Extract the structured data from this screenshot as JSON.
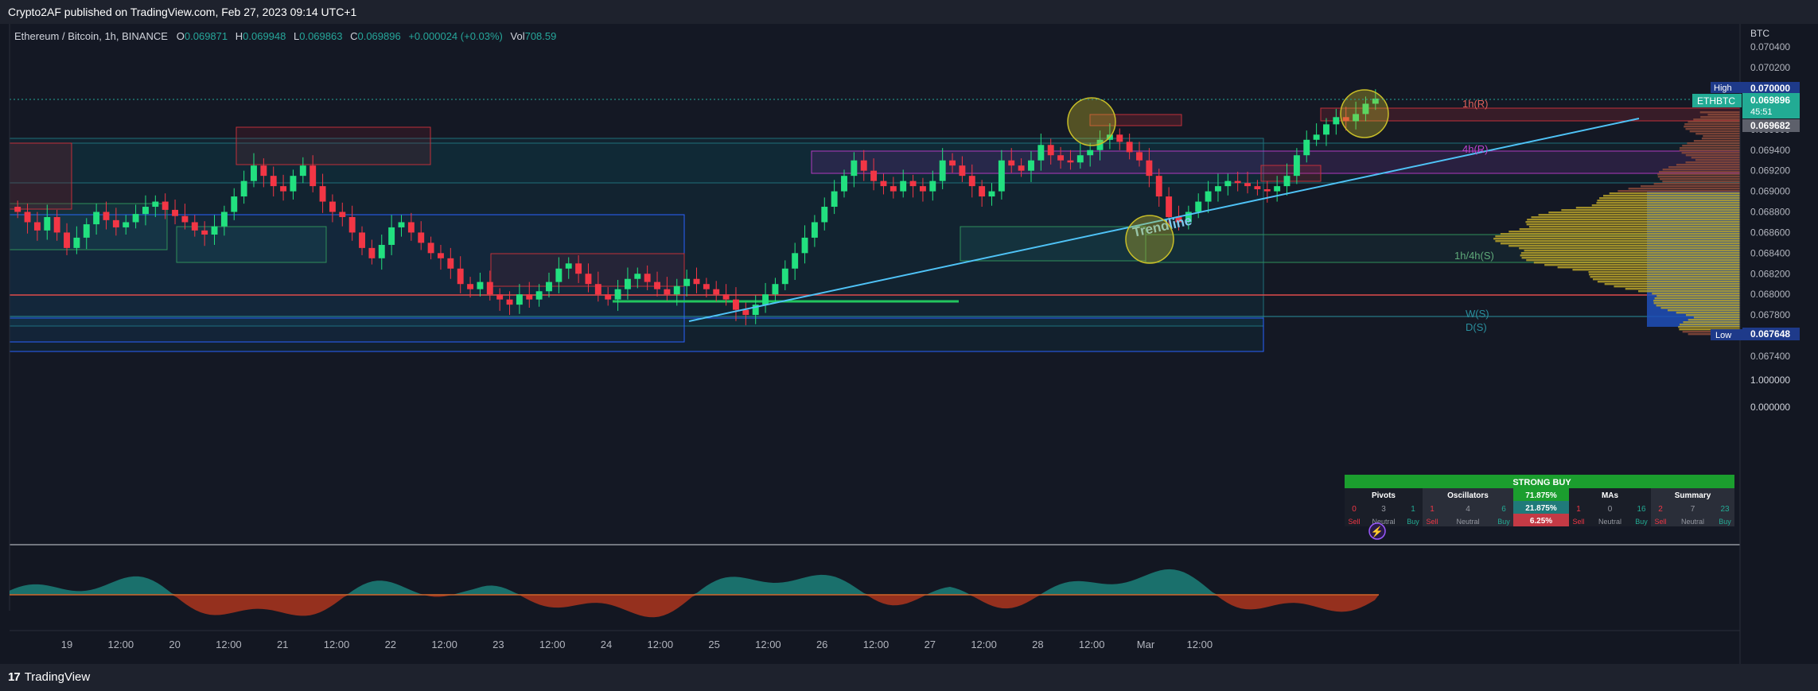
{
  "header": {
    "published": "Crypto2AF published on TradingView.com, Feb 27, 2023 09:14 UTC+1"
  },
  "footer": {
    "brand": "TradingView",
    "logo_mark": "17"
  },
  "legend": {
    "symbol": "Ethereum / Bitcoin, 1h, BINANCE",
    "o_label": "O",
    "o": "0.069871",
    "h_label": "H",
    "h": "0.069948",
    "l_label": "L",
    "l": "0.069863",
    "c_label": "C",
    "c": "0.069896",
    "change": "+0.000024 (+0.03%)",
    "vol_label": "Vol",
    "vol": "708.59"
  },
  "price_scale": {
    "currency": "BTC",
    "ticks": [
      "0.070400",
      "0.070200",
      "0.070000",
      "0.069800",
      "0.069600",
      "0.069400",
      "0.069200",
      "0.069000",
      "0.068800",
      "0.068600",
      "0.068400",
      "0.068200",
      "0.068000",
      "0.067800",
      "0.067600",
      "0.067400"
    ],
    "high_label": "High",
    "high_value": "0.070000",
    "symbol_tag": "ETHBTC",
    "last_price": "0.069896",
    "countdown": "45:51",
    "level_value": "0.069682",
    "low_label": "Low",
    "low_value": "0.067648"
  },
  "osc_scale": {
    "ticks": [
      "1.000000",
      "0.000000"
    ]
  },
  "time_axis": [
    "19",
    "12:00",
    "20",
    "12:00",
    "21",
    "12:00",
    "22",
    "12:00",
    "23",
    "12:00",
    "24",
    "12:00",
    "25",
    "12:00",
    "26",
    "12:00",
    "27",
    "12:00",
    "28",
    "12:00",
    "Mar",
    "12:00"
  ],
  "annotations": {
    "r1h": "1h(R)",
    "r4h": "4h(R)",
    "s1h4h": "1h/4h(S)",
    "sw": "W(S)",
    "sd": "D(S)",
    "trendline": "Trendline"
  },
  "ta_panel": {
    "summary_text": "STRONG BUY",
    "columns": [
      {
        "title": "Pivots",
        "sell": "0",
        "neutral": "3",
        "buy": "1"
      },
      {
        "title": "Oscillators",
        "sell": "1",
        "neutral": "4",
        "buy": "6"
      },
      {
        "title": "MAs",
        "sell": "1",
        "neutral": "0",
        "buy": "16"
      },
      {
        "title": "Summary",
        "sell": "2",
        "neutral": "7",
        "buy": "23"
      }
    ],
    "pct_buy": "71.875%",
    "pct_neutral": "21.875%",
    "pct_sell": "6.25%",
    "sell_label": "Sell",
    "neutral_label": "Neutral",
    "buy_label": "Buy"
  },
  "colors": {
    "up": "#26a69a",
    "up_bright": "#22e07f",
    "down": "#f23645",
    "trendline": "#4fc3f7",
    "bg": "#131722",
    "panel": "#1e222d",
    "buy": "#22ab94",
    "sell": "#f23645"
  },
  "chart_data": {
    "type": "candlestick",
    "symbol": "ETHBTC",
    "timeframe": "1h",
    "x_range": [
      "Feb 19",
      "Mar 1 12:00"
    ],
    "ylim": [
      0.0673,
      0.0705
    ],
    "close_series": [
      0.0688,
      0.0687,
      0.06862,
      0.06875,
      0.0686,
      0.06845,
      0.06855,
      0.06868,
      0.0688,
      0.06872,
      0.06865,
      0.0687,
      0.06878,
      0.06885,
      0.0689,
      0.06882,
      0.06876,
      0.0687,
      0.06862,
      0.06858,
      0.06866,
      0.0688,
      0.06895,
      0.0691,
      0.06925,
      0.06915,
      0.06905,
      0.069,
      0.06915,
      0.06925,
      0.06905,
      0.0689,
      0.0688,
      0.06875,
      0.0686,
      0.06845,
      0.06835,
      0.06848,
      0.06865,
      0.0687,
      0.0686,
      0.0685,
      0.0684,
      0.06835,
      0.06825,
      0.0681,
      0.06805,
      0.06812,
      0.068,
      0.06795,
      0.0679,
      0.068,
      0.06795,
      0.06803,
      0.06812,
      0.06825,
      0.0683,
      0.0682,
      0.0681,
      0.068,
      0.06795,
      0.06805,
      0.06815,
      0.0682,
      0.06812,
      0.06805,
      0.068,
      0.06808,
      0.06815,
      0.0681,
      0.06805,
      0.068,
      0.06795,
      0.06785,
      0.0678,
      0.0679,
      0.068,
      0.0681,
      0.06825,
      0.0684,
      0.06855,
      0.0687,
      0.06885,
      0.069,
      0.06915,
      0.0693,
      0.0692,
      0.0691,
      0.06905,
      0.069,
      0.0691,
      0.06905,
      0.069,
      0.0691,
      0.0693,
      0.06925,
      0.06915,
      0.06905,
      0.06895,
      0.069,
      0.0693,
      0.06925,
      0.0692,
      0.0693,
      0.06945,
      0.06935,
      0.0693,
      0.06928,
      0.06935,
      0.0694,
      0.0695,
      0.06955,
      0.06948,
      0.06938,
      0.0693,
      0.06915,
      0.06895,
      0.06875,
      0.0687,
      0.0688,
      0.0689,
      0.069,
      0.06905,
      0.0691,
      0.06908,
      0.06905,
      0.06902,
      0.069,
      0.06905,
      0.06915,
      0.06935,
      0.0695,
      0.06955,
      0.06965,
      0.06972,
      0.06968,
      0.06975,
      0.06985,
      0.0699
    ]
  }
}
